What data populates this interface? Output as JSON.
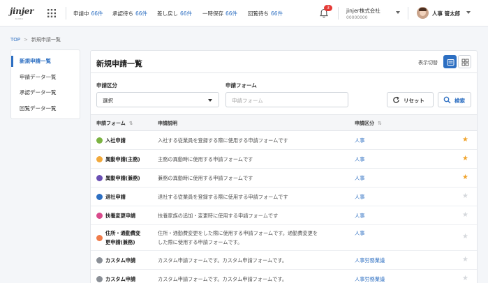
{
  "header": {
    "logo_text": "jinjer",
    "logo_sub": "KUMO",
    "status_items": [
      {
        "label": "申請中",
        "count": "66件"
      },
      {
        "label": "承認待ち",
        "count": "66件"
      },
      {
        "label": "差し戻し",
        "count": "66件"
      },
      {
        "label": "一時保存",
        "count": "66件"
      },
      {
        "label": "回覧待ち",
        "count": "66件"
      }
    ],
    "notification_count": "3",
    "company_name": "jinjer株式会社",
    "company_code": "00000000",
    "user_name": "人事 管太郎"
  },
  "breadcrumb": {
    "top": "TOP",
    "separator": ">",
    "current": "新規申請一覧"
  },
  "sidebar": {
    "items": [
      {
        "label": "新規申請一覧",
        "active": true
      },
      {
        "label": "申請データ一覧",
        "active": false
      },
      {
        "label": "承認データ一覧",
        "active": false
      },
      {
        "label": "回覧データ一覧",
        "active": false
      }
    ]
  },
  "main": {
    "title": "新規申請一覧",
    "view_toggle_label": "表示切替",
    "filters": {
      "category_label": "申請区分",
      "category_value": "選択",
      "form_label": "申請フォーム",
      "form_placeholder": "申請フォーム"
    },
    "reset_label": "リセット",
    "search_label": "検索",
    "table": {
      "headers": {
        "form": "申請フォーム",
        "description": "申請説明",
        "category": "申請区分"
      },
      "rows": [
        {
          "form": "入社申請",
          "description": "入社する従業員を登録する際に使用する申請フォームです",
          "category": "人事",
          "favorite": true,
          "dot_color": "#7cb342"
        },
        {
          "form": "異動申請(主務)",
          "description": "主務の異動時に使用する申請フォームです",
          "category": "人事",
          "favorite": true,
          "dot_color": "#f2a93b"
        },
        {
          "form": "異動申請(兼務)",
          "description": "兼務の異動時に使用する申請フォームです",
          "category": "人事",
          "favorite": true,
          "dot_color": "#6a4fb3"
        },
        {
          "form": "退社申請",
          "description": "退社する従業員を登録する際に使用する申請フォームです",
          "category": "人事",
          "favorite": false,
          "dot_color": "#2d6fc2"
        },
        {
          "form": "扶養変更申請",
          "description": "扶養家族の追加・変更時に使用する申請フォームです",
          "category": "人事",
          "favorite": false,
          "dot_color": "#d94a8c"
        },
        {
          "form": "住所・通勤費変更申請(兼務)",
          "form_lines": [
            "住所・通勤費変",
            "更申請(兼務)"
          ],
          "description": "住所・通勤費変更をした際に使用する申請フォームです。通勤費変更を",
          "description_lines": [
            "住所・通勤費変更をした際に使用する申請フォームです。通勤費変更を",
            "した際に使用する申請フォームです。"
          ],
          "category": "人事",
          "favorite": false,
          "dot_color": "#f07c4a"
        },
        {
          "form": "カスタム申請",
          "description": "カスタム申請フォームです。カスタム申請フォームです。",
          "category": "人事労務業議",
          "favorite": false,
          "dot_color": "#8a8f96"
        },
        {
          "form": "カスタム申請",
          "description": "カスタム申請フォームです。カスタム申請フォームです。",
          "category": "人事労務業議",
          "favorite": false,
          "dot_color": "#8a8f96"
        }
      ]
    }
  },
  "colors": {
    "accent": "#2d6fc2",
    "star_on": "#f0a32b",
    "star_off": "#d5d8dc",
    "badge": "#e53935"
  }
}
